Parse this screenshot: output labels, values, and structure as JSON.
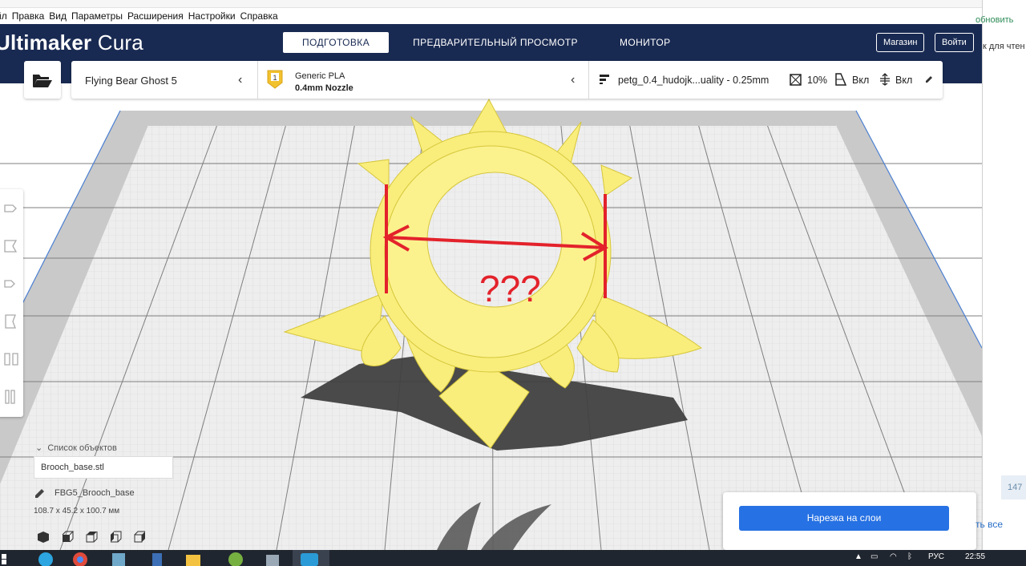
{
  "menu": [
    "йл",
    "Правка",
    "Вид",
    "Параметры",
    "Расширения",
    "Настройки",
    "Справка"
  ],
  "app": {
    "brand_bold": "Ultimaker",
    "brand_light": " Cura"
  },
  "stages": [
    "ПОДГОТОВКА",
    "ПРЕДВАРИТЕЛЬНЫЙ ПРОСМОТР",
    "МОНИТОР"
  ],
  "header_buttons": {
    "marketplace": "Магазин",
    "signin": "Войти"
  },
  "printer": {
    "name": "Flying Bear Ghost 5"
  },
  "material": {
    "badge": "1",
    "name": "Generic PLA",
    "nozzle": "0.4mm Nozzle",
    "color": "#f2c12e"
  },
  "profile": {
    "name": "petg_0.4_hudojk...uality - 0.25mm",
    "infill": "10%",
    "support": "Вкл",
    "adhesion": "Вкл"
  },
  "annotation": {
    "text": "???",
    "color": "#e3222b"
  },
  "objects": {
    "header": "Список объектов",
    "file": "Brooch_base.stl",
    "name": "FBG5_Brooch_base",
    "dims": "108.7 x 45.2 x 100.7 мм"
  },
  "slice": {
    "label": "Нарезка на слои"
  },
  "side_window": {
    "update": "обновить",
    "read": "к для чтен",
    "count": "147",
    "all": "ть все"
  },
  "taskbar": {
    "lang": "РУС",
    "time": "22:55",
    "apps": [
      "start-icon",
      "telegram-icon",
      "chrome-icon",
      "app-icon",
      "calculator-icon",
      "folder-icon",
      "utorrent-icon",
      "image-app-icon",
      "cura-icon"
    ]
  },
  "colors": {
    "header_bg": "#192a52",
    "slice_button": "#2671e3",
    "model_yellow": "#f9ee7c"
  }
}
